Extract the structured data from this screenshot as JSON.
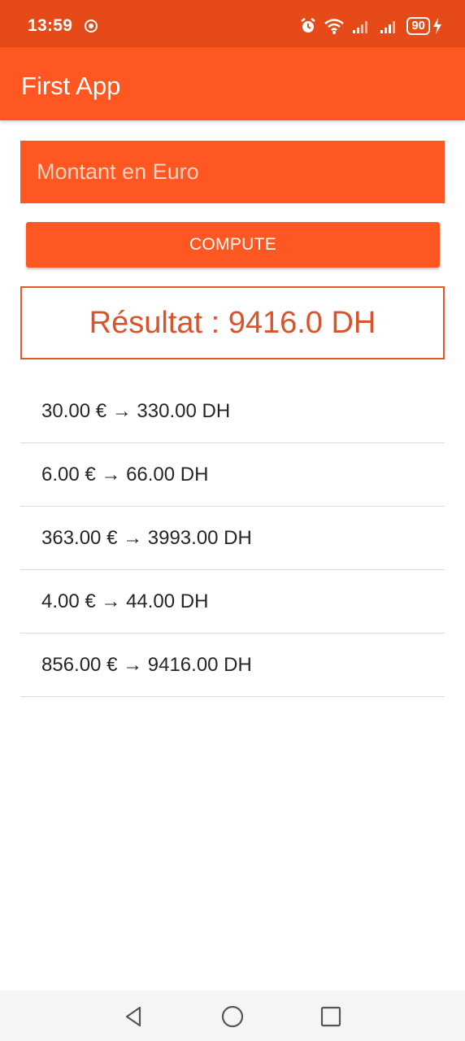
{
  "status_bar": {
    "time": "13:59",
    "battery": "90",
    "icons": [
      "whatsapp-icon",
      "alarm-icon",
      "wifi-icon",
      "signal-icon",
      "signal-icon",
      "battery-icon",
      "charging-icon"
    ]
  },
  "app_bar": {
    "title": "First App"
  },
  "input": {
    "placeholder": "Montant en Euro",
    "value": ""
  },
  "compute_button": {
    "label": "COMPUTE"
  },
  "result": {
    "text": "Résultat : 9416.0 DH"
  },
  "history": [
    {
      "text": "30.00 € → 330.00 DH"
    },
    {
      "text": "6.00 € → 66.00 DH"
    },
    {
      "text": "363.00 € → 3993.00 DH"
    },
    {
      "text": "4.00 € → 44.00 DH"
    },
    {
      "text": "856.00 € → 9416.00 DH"
    }
  ],
  "nav_bar": {
    "buttons": [
      "back-icon",
      "home-icon",
      "recents-icon"
    ]
  },
  "colors": {
    "status_bar": "#e64a19",
    "accent": "#ff5722",
    "result_border": "#e2572c",
    "result_text": "#d9542a"
  }
}
